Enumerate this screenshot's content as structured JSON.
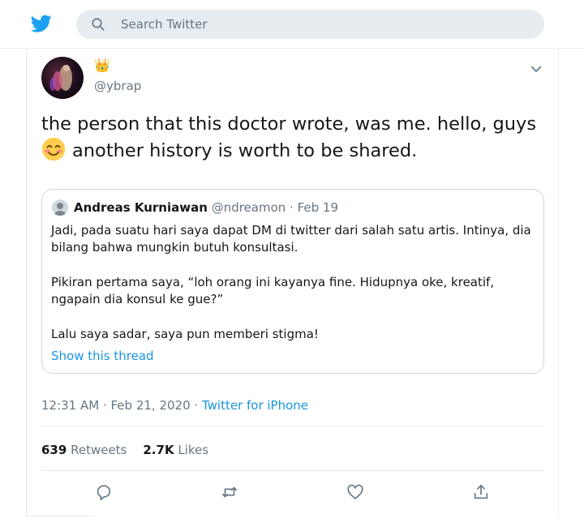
{
  "search": {
    "placeholder": "Search Twitter"
  },
  "tweet": {
    "crown_emoji": "👑",
    "handle": "@ybrap",
    "text_line1": "the person that this doctor wrote, was me. hello, guys",
    "text_line2": "another history is worth to be shared.",
    "timestamp": "12:31 AM · Feb 21, 2020 ·",
    "source": "Twitter for iPhone",
    "retweets_count": "639",
    "retweets_label": "Retweets",
    "likes_count": "2.7K",
    "likes_label": "Likes"
  },
  "quote": {
    "name": "Andreas Kurniawan",
    "meta": "@ndreamon · Feb 19",
    "paragraphs": [
      "Jadi, pada suatu hari saya dapat DM di twitter dari salah satu artis. Intinya, dia bilang bahwa mungkin butuh konsultasi.",
      "Pikiran pertama saya, “loh orang ini kayanya fine. Hidupnya oke, kreatif, ngapain dia konsul ke gue?”",
      "Lalu saya sadar, saya pun memberi stigma!"
    ],
    "show_thread": "Show this thread"
  },
  "icons": {
    "logo": "twitter-bird-icon",
    "search": "search-icon",
    "more": "chevron-down-icon",
    "reply": "reply-icon",
    "retweet": "retweet-icon",
    "like": "like-icon",
    "share": "share-icon"
  },
  "colors": {
    "brand": "#1da1f2",
    "link": "#1b95e0",
    "muted": "#657786",
    "search_bg": "#e6ecf0"
  }
}
